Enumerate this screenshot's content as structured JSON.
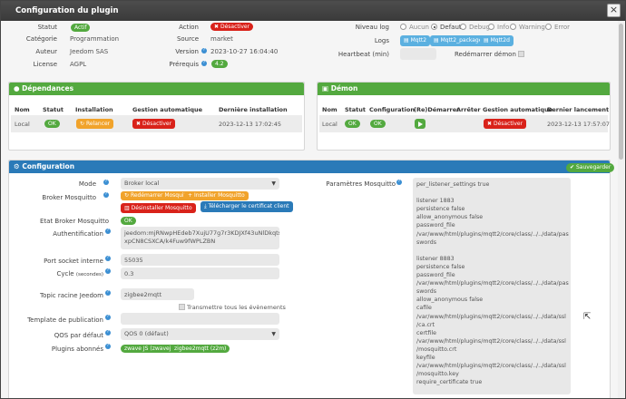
{
  "modal": {
    "title": "Configuration du plugin",
    "close": "×"
  },
  "info": {
    "status_label": "Statut",
    "status_value": "Actif",
    "category_label": "Catégorie",
    "category_value": "Programmation",
    "author_label": "Auteur",
    "author_value": "Jeedom SAS",
    "license_label": "License",
    "license_value": "AGPL",
    "action_label": "Action",
    "action_button": "Désactiver",
    "source_label": "Source",
    "source_value": "market",
    "version_label": "Version",
    "version_value": "2023-10-27 16:04:40",
    "prereq_label": "Prérequis",
    "prereq_value": "4.2"
  },
  "log": {
    "level_label": "Niveau log",
    "levels": [
      "Aucun",
      "Defaut",
      "Debug",
      "Info",
      "Warning",
      "Error"
    ],
    "logs_label": "Logs",
    "log_buttons": [
      "Mqtt2",
      "Mqtt2_packages",
      "Mqtt2d"
    ],
    "heartbeat_label": "Heartbeat (min)",
    "restart_label": "Redémarrer démon"
  },
  "deps": {
    "title": "Dépendances",
    "headers": [
      "Nom",
      "Statut",
      "Installation",
      "Gestion automatique",
      "Dernière installation"
    ],
    "row": {
      "name": "Local",
      "status": "OK",
      "install": "Relancer",
      "auto": "Désactiver",
      "last": "2023-12-13 17:02:45"
    }
  },
  "daemon": {
    "title": "Démon",
    "headers": [
      "Nom",
      "Statut",
      "Configuration",
      "(Re)Démarrer",
      "Arrêter",
      "Gestion automatique",
      "Dernier lancement"
    ],
    "row": {
      "name": "Local",
      "status": "OK",
      "config": "OK",
      "auto": "Désactiver",
      "last": "2023-12-13 17:57:07"
    }
  },
  "config": {
    "title": "Configuration",
    "save": "Sauvegarder",
    "mode_label": "Mode",
    "mode_value": "Broker local",
    "broker_label": "Broker Mosquitto",
    "broker_buttons": {
      "restart": "Redémarrer Mosquitto",
      "install": "Installer Mosquitto",
      "uninstall": "Désinstaller Mosquitto",
      "download": "Télécharger le certificat client"
    },
    "broker_state_label": "Etat Broker Mosquitto",
    "broker_state_value": "OK",
    "auth_label": "Authentification",
    "auth_value_1": "jeedom:mjRNwpHEdeb7XujU77g7r3KDJXf43uNlDkqts91W",
    "auth_value_2": "xpCN8CSXCA/k4Fuw9fWPLZBN",
    "port_label": "Port socket interne",
    "port_value": "55035",
    "cycle_label": "Cycle",
    "cycle_unit": "(secondes)",
    "cycle_value": "0.3",
    "topic_label": "Topic racine Jeedom",
    "topic_value": "zigbee2mqtt",
    "transmit_label": "Transmettre tous les évènements",
    "template_label": "Template de publication",
    "qos_label": "QOS par défaut",
    "qos_value": "QOS 0 (défaut)",
    "plugins_label": "Plugins abonnés",
    "plugins": [
      "zwave JS (zwavejs)",
      "zigbee2mqtt (z2m)"
    ],
    "params_label": "Paramètres Mosquitto",
    "params_value": "per_listener_settings true\n\nlistener 1883\npersistence false\nallow_anonymous false\npassword_file\n/var/www/html/plugins/mqtt2/core/class/../../data/pas\nswords\n\nlistener 8883\npersistence false\npassword_file\n/var/www/html/plugins/mqtt2/core/class/../../data/pas\nswords\nallow_anonymous false\ncafile\n/var/www/html/plugins/mqtt2/core/class/../../data/ssl\n/ca.crt\ncertfile\n/var/www/html/plugins/mqtt2/core/class/../../data/ssl\n/mosquitto.crt\nkeyfile\n/var/www/html/plugins/mqtt2/core/class/../../data/ssl\n/mosquitto.key\nrequire_certificate true"
  }
}
